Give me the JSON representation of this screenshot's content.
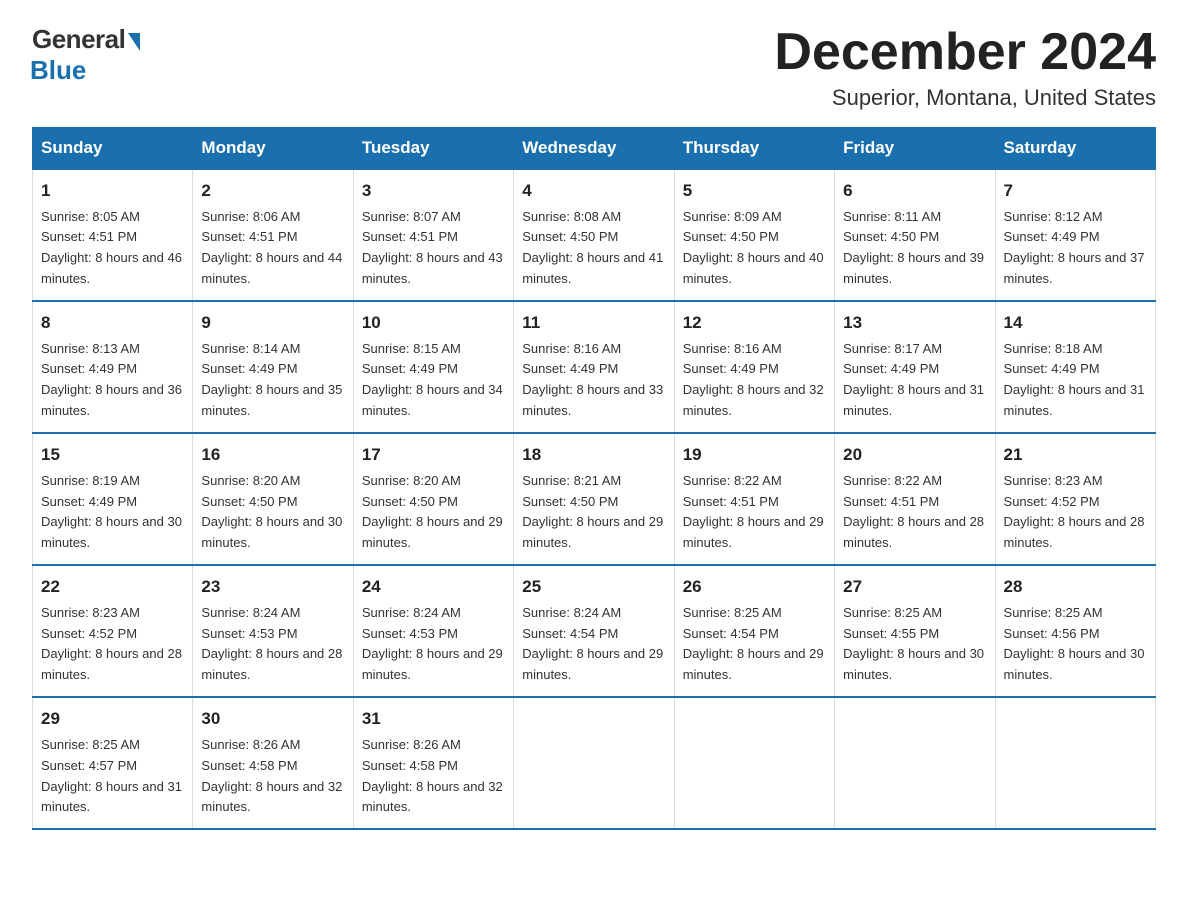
{
  "logo": {
    "general": "General",
    "blue": "Blue"
  },
  "title": "December 2024",
  "subtitle": "Superior, Montana, United States",
  "days_header": [
    "Sunday",
    "Monday",
    "Tuesday",
    "Wednesday",
    "Thursday",
    "Friday",
    "Saturday"
  ],
  "weeks": [
    [
      {
        "num": "1",
        "sunrise": "8:05 AM",
        "sunset": "4:51 PM",
        "daylight": "8 hours and 46 minutes."
      },
      {
        "num": "2",
        "sunrise": "8:06 AM",
        "sunset": "4:51 PM",
        "daylight": "8 hours and 44 minutes."
      },
      {
        "num": "3",
        "sunrise": "8:07 AM",
        "sunset": "4:51 PM",
        "daylight": "8 hours and 43 minutes."
      },
      {
        "num": "4",
        "sunrise": "8:08 AM",
        "sunset": "4:50 PM",
        "daylight": "8 hours and 41 minutes."
      },
      {
        "num": "5",
        "sunrise": "8:09 AM",
        "sunset": "4:50 PM",
        "daylight": "8 hours and 40 minutes."
      },
      {
        "num": "6",
        "sunrise": "8:11 AM",
        "sunset": "4:50 PM",
        "daylight": "8 hours and 39 minutes."
      },
      {
        "num": "7",
        "sunrise": "8:12 AM",
        "sunset": "4:49 PM",
        "daylight": "8 hours and 37 minutes."
      }
    ],
    [
      {
        "num": "8",
        "sunrise": "8:13 AM",
        "sunset": "4:49 PM",
        "daylight": "8 hours and 36 minutes."
      },
      {
        "num": "9",
        "sunrise": "8:14 AM",
        "sunset": "4:49 PM",
        "daylight": "8 hours and 35 minutes."
      },
      {
        "num": "10",
        "sunrise": "8:15 AM",
        "sunset": "4:49 PM",
        "daylight": "8 hours and 34 minutes."
      },
      {
        "num": "11",
        "sunrise": "8:16 AM",
        "sunset": "4:49 PM",
        "daylight": "8 hours and 33 minutes."
      },
      {
        "num": "12",
        "sunrise": "8:16 AM",
        "sunset": "4:49 PM",
        "daylight": "8 hours and 32 minutes."
      },
      {
        "num": "13",
        "sunrise": "8:17 AM",
        "sunset": "4:49 PM",
        "daylight": "8 hours and 31 minutes."
      },
      {
        "num": "14",
        "sunrise": "8:18 AM",
        "sunset": "4:49 PM",
        "daylight": "8 hours and 31 minutes."
      }
    ],
    [
      {
        "num": "15",
        "sunrise": "8:19 AM",
        "sunset": "4:49 PM",
        "daylight": "8 hours and 30 minutes."
      },
      {
        "num": "16",
        "sunrise": "8:20 AM",
        "sunset": "4:50 PM",
        "daylight": "8 hours and 30 minutes."
      },
      {
        "num": "17",
        "sunrise": "8:20 AM",
        "sunset": "4:50 PM",
        "daylight": "8 hours and 29 minutes."
      },
      {
        "num": "18",
        "sunrise": "8:21 AM",
        "sunset": "4:50 PM",
        "daylight": "8 hours and 29 minutes."
      },
      {
        "num": "19",
        "sunrise": "8:22 AM",
        "sunset": "4:51 PM",
        "daylight": "8 hours and 29 minutes."
      },
      {
        "num": "20",
        "sunrise": "8:22 AM",
        "sunset": "4:51 PM",
        "daylight": "8 hours and 28 minutes."
      },
      {
        "num": "21",
        "sunrise": "8:23 AM",
        "sunset": "4:52 PM",
        "daylight": "8 hours and 28 minutes."
      }
    ],
    [
      {
        "num": "22",
        "sunrise": "8:23 AM",
        "sunset": "4:52 PM",
        "daylight": "8 hours and 28 minutes."
      },
      {
        "num": "23",
        "sunrise": "8:24 AM",
        "sunset": "4:53 PM",
        "daylight": "8 hours and 28 minutes."
      },
      {
        "num": "24",
        "sunrise": "8:24 AM",
        "sunset": "4:53 PM",
        "daylight": "8 hours and 29 minutes."
      },
      {
        "num": "25",
        "sunrise": "8:24 AM",
        "sunset": "4:54 PM",
        "daylight": "8 hours and 29 minutes."
      },
      {
        "num": "26",
        "sunrise": "8:25 AM",
        "sunset": "4:54 PM",
        "daylight": "8 hours and 29 minutes."
      },
      {
        "num": "27",
        "sunrise": "8:25 AM",
        "sunset": "4:55 PM",
        "daylight": "8 hours and 30 minutes."
      },
      {
        "num": "28",
        "sunrise": "8:25 AM",
        "sunset": "4:56 PM",
        "daylight": "8 hours and 30 minutes."
      }
    ],
    [
      {
        "num": "29",
        "sunrise": "8:25 AM",
        "sunset": "4:57 PM",
        "daylight": "8 hours and 31 minutes."
      },
      {
        "num": "30",
        "sunrise": "8:26 AM",
        "sunset": "4:58 PM",
        "daylight": "8 hours and 32 minutes."
      },
      {
        "num": "31",
        "sunrise": "8:26 AM",
        "sunset": "4:58 PM",
        "daylight": "8 hours and 32 minutes."
      },
      null,
      null,
      null,
      null
    ]
  ]
}
